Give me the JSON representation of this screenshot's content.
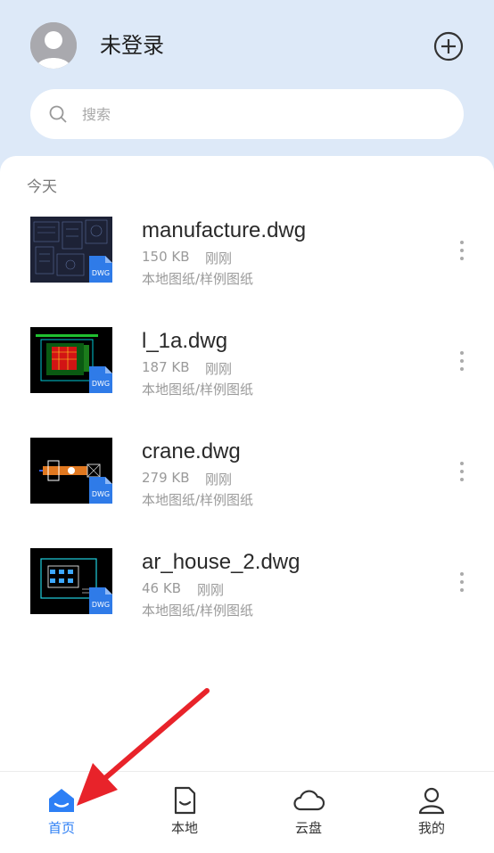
{
  "header": {
    "username": "未登录",
    "search_placeholder": "搜索"
  },
  "section": {
    "label": "今天"
  },
  "files": [
    {
      "name": "manufacture.dwg",
      "size": "150 KB",
      "time": "刚刚",
      "path": "本地图纸/样例图纸",
      "badge": "DWG"
    },
    {
      "name": "l_1a.dwg",
      "size": "187 KB",
      "time": "刚刚",
      "path": "本地图纸/样例图纸",
      "badge": "DWG"
    },
    {
      "name": "crane.dwg",
      "size": "279 KB",
      "time": "刚刚",
      "path": "本地图纸/样例图纸",
      "badge": "DWG"
    },
    {
      "name": "ar_house_2.dwg",
      "size": "46 KB",
      "time": "刚刚",
      "path": "本地图纸/样例图纸",
      "badge": "DWG"
    }
  ],
  "tabs": [
    {
      "label": "首页",
      "icon": "home-icon",
      "active": true
    },
    {
      "label": "本地",
      "icon": "local-file-icon",
      "active": false
    },
    {
      "label": "云盘",
      "icon": "cloud-icon",
      "active": false
    },
    {
      "label": "我的",
      "icon": "user-icon",
      "active": false
    }
  ],
  "colors": {
    "header_bg": "#dde9f8",
    "accent": "#2d7ff5",
    "annotation_arrow": "#e8232a",
    "dwg_badge": "#2f7be8"
  }
}
